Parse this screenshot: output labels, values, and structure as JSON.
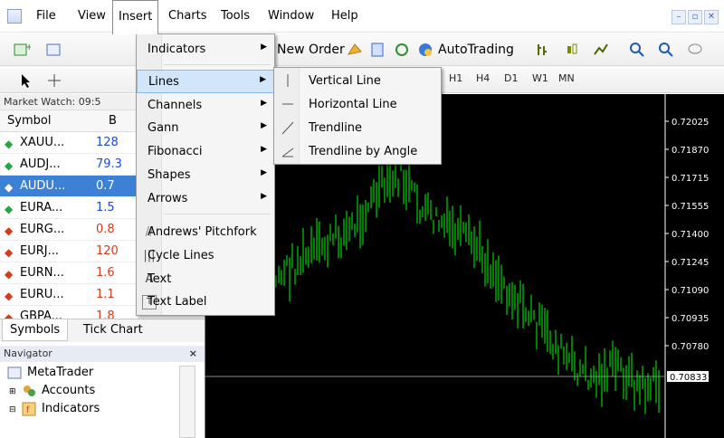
{
  "menubar": {
    "items": [
      {
        "label": "File"
      },
      {
        "label": "View"
      },
      {
        "label": "Insert"
      },
      {
        "label": "Charts"
      },
      {
        "label": "Tools"
      },
      {
        "label": "Window"
      },
      {
        "label": "Help"
      }
    ]
  },
  "toolbar": {
    "new_order": "New Order",
    "autotrading": "AutoTrading"
  },
  "timeframes": [
    "H1",
    "H4",
    "D1",
    "W1",
    "MN"
  ],
  "market_watch": {
    "title": "Market Watch: 09:5",
    "col_symbol": "Symbol",
    "col_bid": "B",
    "rows": [
      {
        "symbol": "XAUU...",
        "value": "128",
        "dir": "up"
      },
      {
        "symbol": "AUDJ...",
        "value": "79.3",
        "dir": "up"
      },
      {
        "symbol": "AUDU...",
        "value": "0.7",
        "dir": "down"
      },
      {
        "symbol": "EURA...",
        "value": "1.5",
        "dir": "up"
      },
      {
        "symbol": "EURG...",
        "value": "0.8",
        "dir": "down"
      },
      {
        "symbol": "EURJ...",
        "value": "120",
        "dir": "down"
      },
      {
        "symbol": "EURN...",
        "value": "1.6",
        "dir": "down"
      },
      {
        "symbol": "EURU...",
        "value": "1.1",
        "dir": "down"
      },
      {
        "symbol": "GBPA...",
        "value": "1.8",
        "dir": "down"
      }
    ]
  },
  "tabs": {
    "symbols": "Symbols",
    "tick_chart": "Tick Chart"
  },
  "navigator": {
    "title": "Navigator",
    "close": "×",
    "items": [
      "MetaTrader",
      "Accounts",
      "Indicators"
    ]
  },
  "insert_menu": {
    "items": [
      {
        "label": "Indicators",
        "submenu": true
      },
      {
        "label": "Lines",
        "submenu": true
      },
      {
        "label": "Channels",
        "submenu": true
      },
      {
        "label": "Gann",
        "submenu": true
      },
      {
        "label": "Fibonacci",
        "submenu": true
      },
      {
        "label": "Shapes",
        "submenu": true
      },
      {
        "label": "Arrows",
        "submenu": true
      },
      {
        "label": "Andrews' Pitchfork",
        "submenu": false
      },
      {
        "label": "Cycle Lines",
        "submenu": false
      },
      {
        "label": "Text",
        "submenu": false
      },
      {
        "label": "Text Label",
        "submenu": false
      }
    ]
  },
  "lines_submenu": {
    "items": [
      {
        "label": "Vertical Line"
      },
      {
        "label": "Horizontal Line"
      },
      {
        "label": "Trendline"
      },
      {
        "label": "Trendline by Angle"
      }
    ]
  },
  "chart": {
    "price_labels": [
      "0.72025",
      "0.71870",
      "0.71715",
      "0.71555",
      "0.71400",
      "0.71245",
      "0.71090",
      "0.70935",
      "0.70780"
    ],
    "current_price": "0.70833",
    "colors": {
      "candles": "#00ff00",
      "background": "#000000",
      "axis": "#ffffff"
    }
  }
}
